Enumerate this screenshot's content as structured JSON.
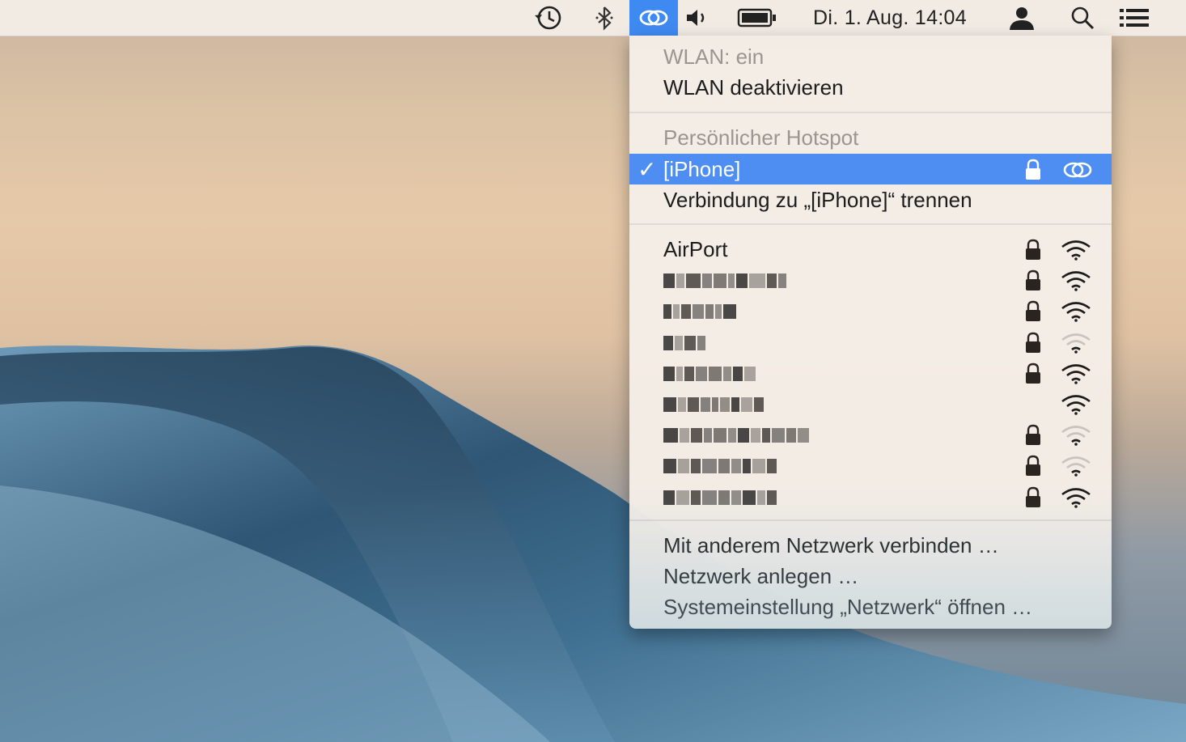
{
  "menubar": {
    "icons": [
      "time-machine-icon",
      "bluetooth-icon",
      "wlan-hotspot-icon",
      "volume-icon",
      "battery-icon",
      "user-icon",
      "spotlight-search-icon",
      "notification-center-icon"
    ],
    "clock": "Di. 1. Aug.  14:04",
    "active_color": "#3f8af2"
  },
  "wlan_menu": {
    "status": "WLAN: ein",
    "toggle": "WLAN deaktivieren",
    "hotspot_header": "Persönlicher Hotspot",
    "hotspot": {
      "name": "[iPhone]",
      "checkmark": "✓",
      "locked": true,
      "disconnect": "Verbindung zu „[iPhone]“ trennen"
    },
    "networks": [
      {
        "name": "AirPort",
        "locked": true,
        "signal": 3,
        "obscured": false
      },
      {
        "name": "",
        "locked": true,
        "signal": 3,
        "obscured": true
      },
      {
        "name": "",
        "locked": true,
        "signal": 3,
        "obscured": true
      },
      {
        "name": "",
        "locked": true,
        "signal": 1,
        "obscured": true
      },
      {
        "name": "",
        "locked": true,
        "signal": 3,
        "obscured": true
      },
      {
        "name": "",
        "locked": false,
        "signal": 3,
        "obscured": true
      },
      {
        "name": "",
        "locked": true,
        "signal": 1,
        "obscured": true
      },
      {
        "name": "",
        "locked": true,
        "signal": 1,
        "obscured": true
      },
      {
        "name": "",
        "locked": true,
        "signal": 3,
        "obscured": true
      }
    ],
    "actions": [
      "Mit anderem Netzwerk verbinden …",
      "Netzwerk anlegen …",
      "Systemeinstellung „Netzwerk“ öffnen …"
    ],
    "selected_color": "#4e8ef2"
  }
}
